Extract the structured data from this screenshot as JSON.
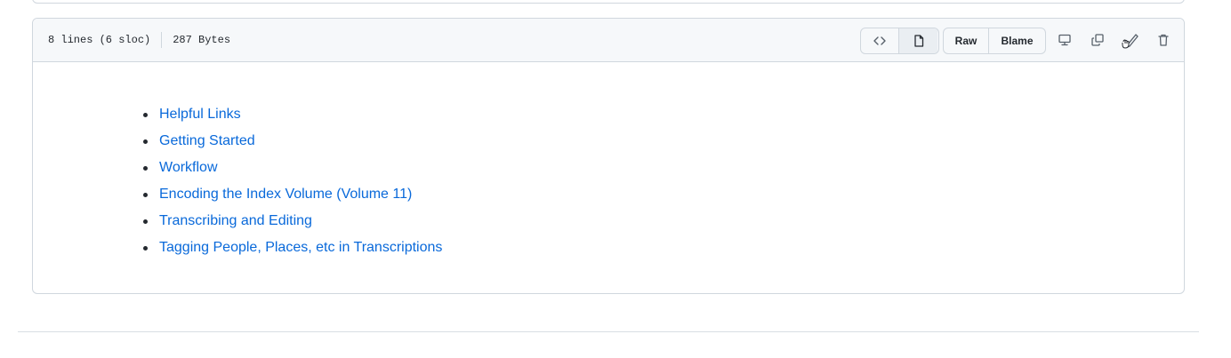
{
  "file_header": {
    "lines_info": "8 lines (6 sloc)",
    "size_info": "287 Bytes",
    "raw_label": "Raw",
    "blame_label": "Blame"
  },
  "toolbar_icons": [
    "code-icon",
    "file-icon",
    "desktop-icon",
    "copy-icon",
    "pencil-icon",
    "trash-icon"
  ],
  "toc": {
    "links": [
      {
        "label": "Helpful Links"
      },
      {
        "label": "Getting Started"
      },
      {
        "label": "Workflow"
      },
      {
        "label": "Encoding the Index Volume (Volume 11)"
      },
      {
        "label": "Transcribing and Editing"
      },
      {
        "label": "Tagging People, Places, etc in Transcriptions"
      }
    ]
  },
  "colors": {
    "link": "#0969da",
    "border": "#d0d7de",
    "header_bg": "#f6f8fa",
    "text": "#24292f"
  }
}
